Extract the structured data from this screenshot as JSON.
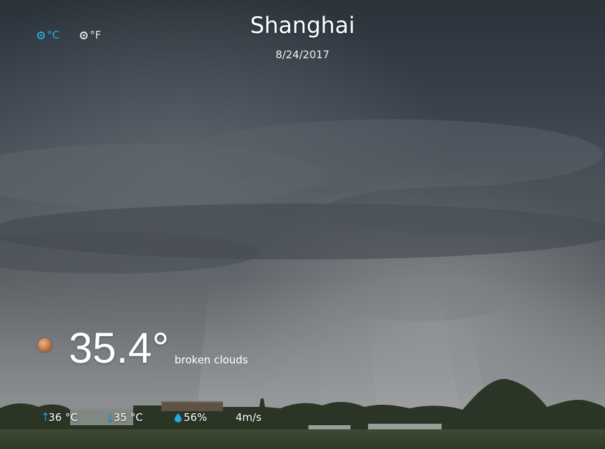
{
  "units": {
    "celsius_label": "°C",
    "fahrenheit_label": "°F",
    "selected": "celsius"
  },
  "location": {
    "city": "Shanghai",
    "date": "8/24/2017"
  },
  "current": {
    "temperature": "35.4°",
    "description": "broken clouds",
    "icon": "broken-clouds-icon"
  },
  "stats": {
    "high": "36 °C",
    "low": "35 °C",
    "humidity": "56%",
    "wind": "4m/s"
  },
  "colors": {
    "accent": "#29a8e0",
    "text": "#ffffff"
  }
}
